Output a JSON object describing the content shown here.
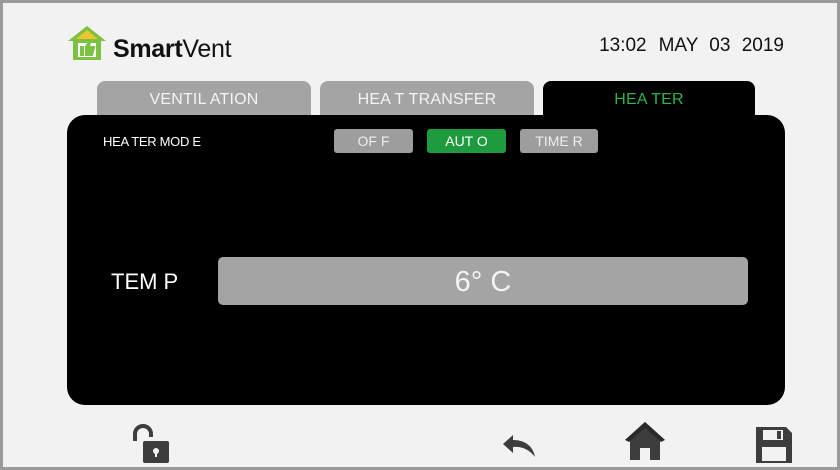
{
  "brand": {
    "name_bold": "Smart",
    "name_regular": "Vent"
  },
  "clock": {
    "time": "13:02",
    "date": "MAY 03 2019"
  },
  "tabs": [
    {
      "label": "VENTIL ATION",
      "active": false
    },
    {
      "label": "HEA T TRANSFER",
      "active": false
    },
    {
      "label": "HEA TER",
      "active": true
    }
  ],
  "heater": {
    "mode_label": "HEA TER MOD  E",
    "modes": [
      {
        "label": "OF F",
        "selected": false
      },
      {
        "label": "AUT O",
        "selected": true
      },
      {
        "label": "TIME R",
        "selected": false
      }
    ],
    "temp_label": "TEM P",
    "temp_value": "6° C"
  },
  "bottom_bar": {
    "icons": [
      "unlock-icon",
      "back-icon",
      "home-icon",
      "save-icon"
    ]
  },
  "colors": {
    "accent_green": "#1f9b3f",
    "active_tab_text": "#2fb34a",
    "inactive_gray": "#a4a4a4",
    "panel": "#000000",
    "icon_dark": "#3d3d3d",
    "logo_green": "#7cc242"
  }
}
